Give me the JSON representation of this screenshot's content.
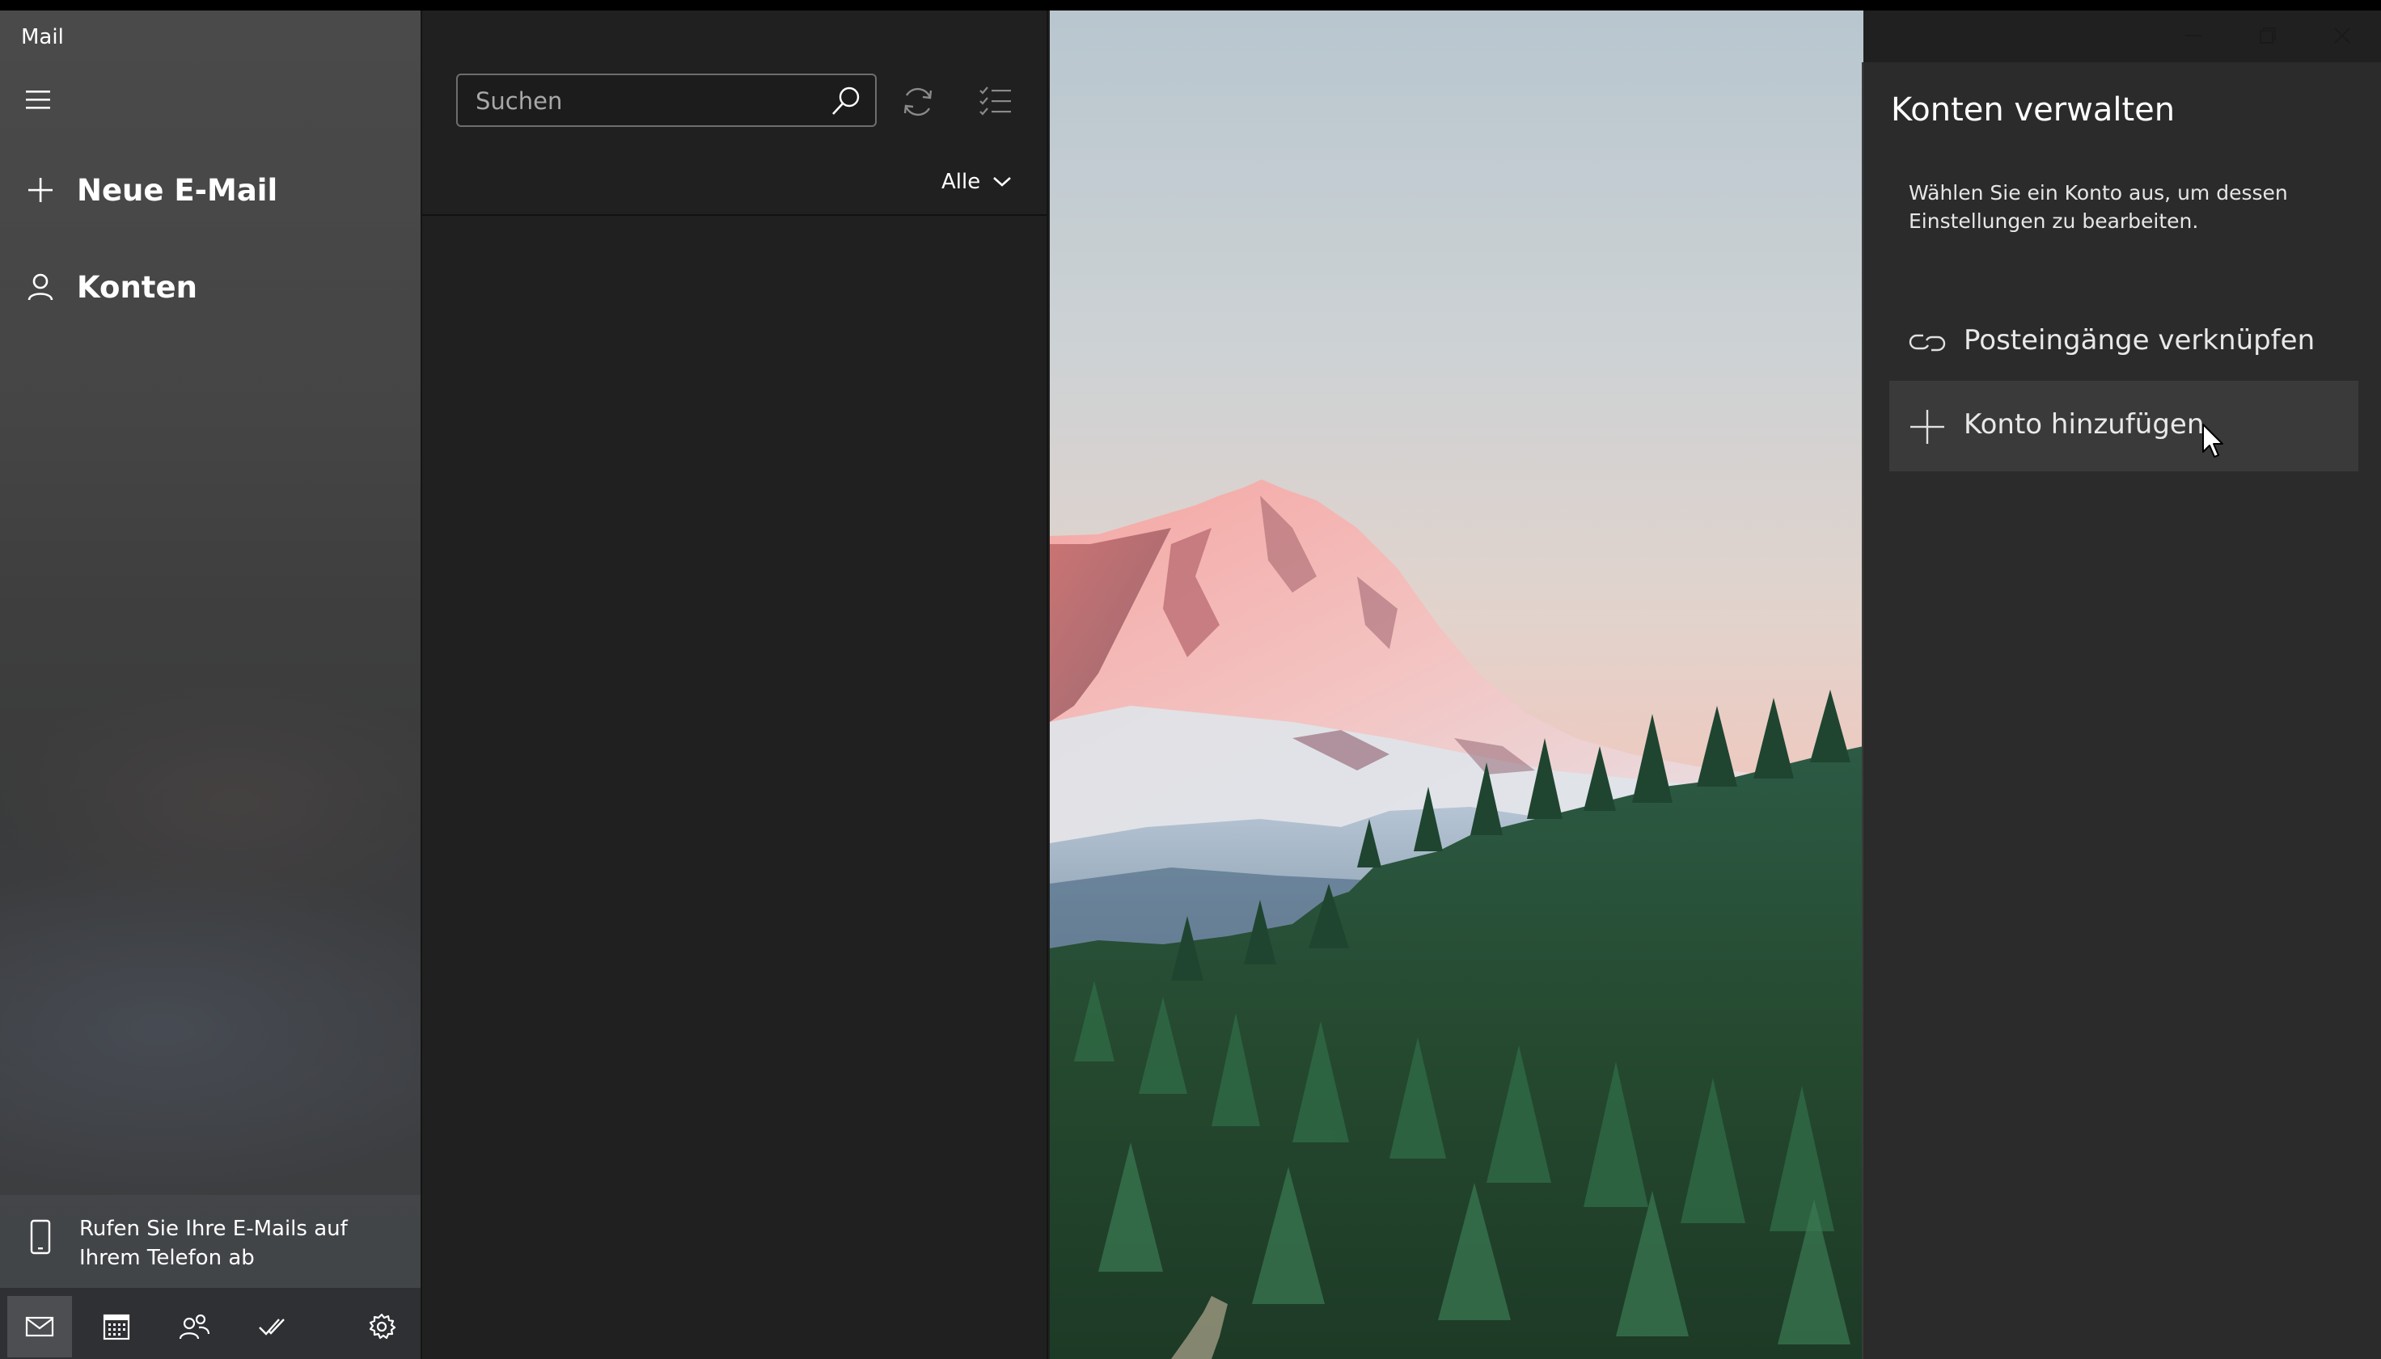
{
  "app": {
    "title": "Mail"
  },
  "nav": {
    "menu_icon": "hamburger-icon",
    "new_mail": {
      "label": "Neue E-Mail",
      "icon": "plus-icon"
    },
    "accounts": {
      "label": "Konten",
      "icon": "person-icon"
    },
    "phone_banner": {
      "text": "Rufen Sie Ihre E-Mails auf Ihrem Telefon ab",
      "icon": "phone-icon"
    },
    "bottom": [
      {
        "name": "mail",
        "icon": "mail-icon",
        "active": true
      },
      {
        "name": "calendar",
        "icon": "calendar-icon",
        "active": false
      },
      {
        "name": "people",
        "icon": "people-icon",
        "active": false
      },
      {
        "name": "todo",
        "icon": "checkmark-icon",
        "active": false
      },
      {
        "name": "settings",
        "icon": "gear-icon",
        "active": false
      }
    ]
  },
  "list": {
    "search": {
      "placeholder": "Suchen",
      "value": ""
    },
    "sync_icon": "sync-icon",
    "select_icon": "select-mode-icon",
    "filter": {
      "label": "Alle"
    }
  },
  "flyout": {
    "title": "Konten verwalten",
    "description": "Wählen Sie ein Konto aus, um dessen Einstellungen zu bearbeiten.",
    "items": [
      {
        "label": "Posteingänge verknüpfen",
        "icon": "link-icon"
      },
      {
        "label": "Konto hinzufügen",
        "icon": "plus-icon"
      }
    ]
  },
  "window": {
    "controls": [
      "minimize-icon",
      "restore-icon",
      "close-icon"
    ]
  },
  "colors": {
    "app_background": "#202020",
    "flyout_background": "#2b2b2b",
    "hover_item": "#3a3a3a",
    "text": "#ffffff"
  }
}
